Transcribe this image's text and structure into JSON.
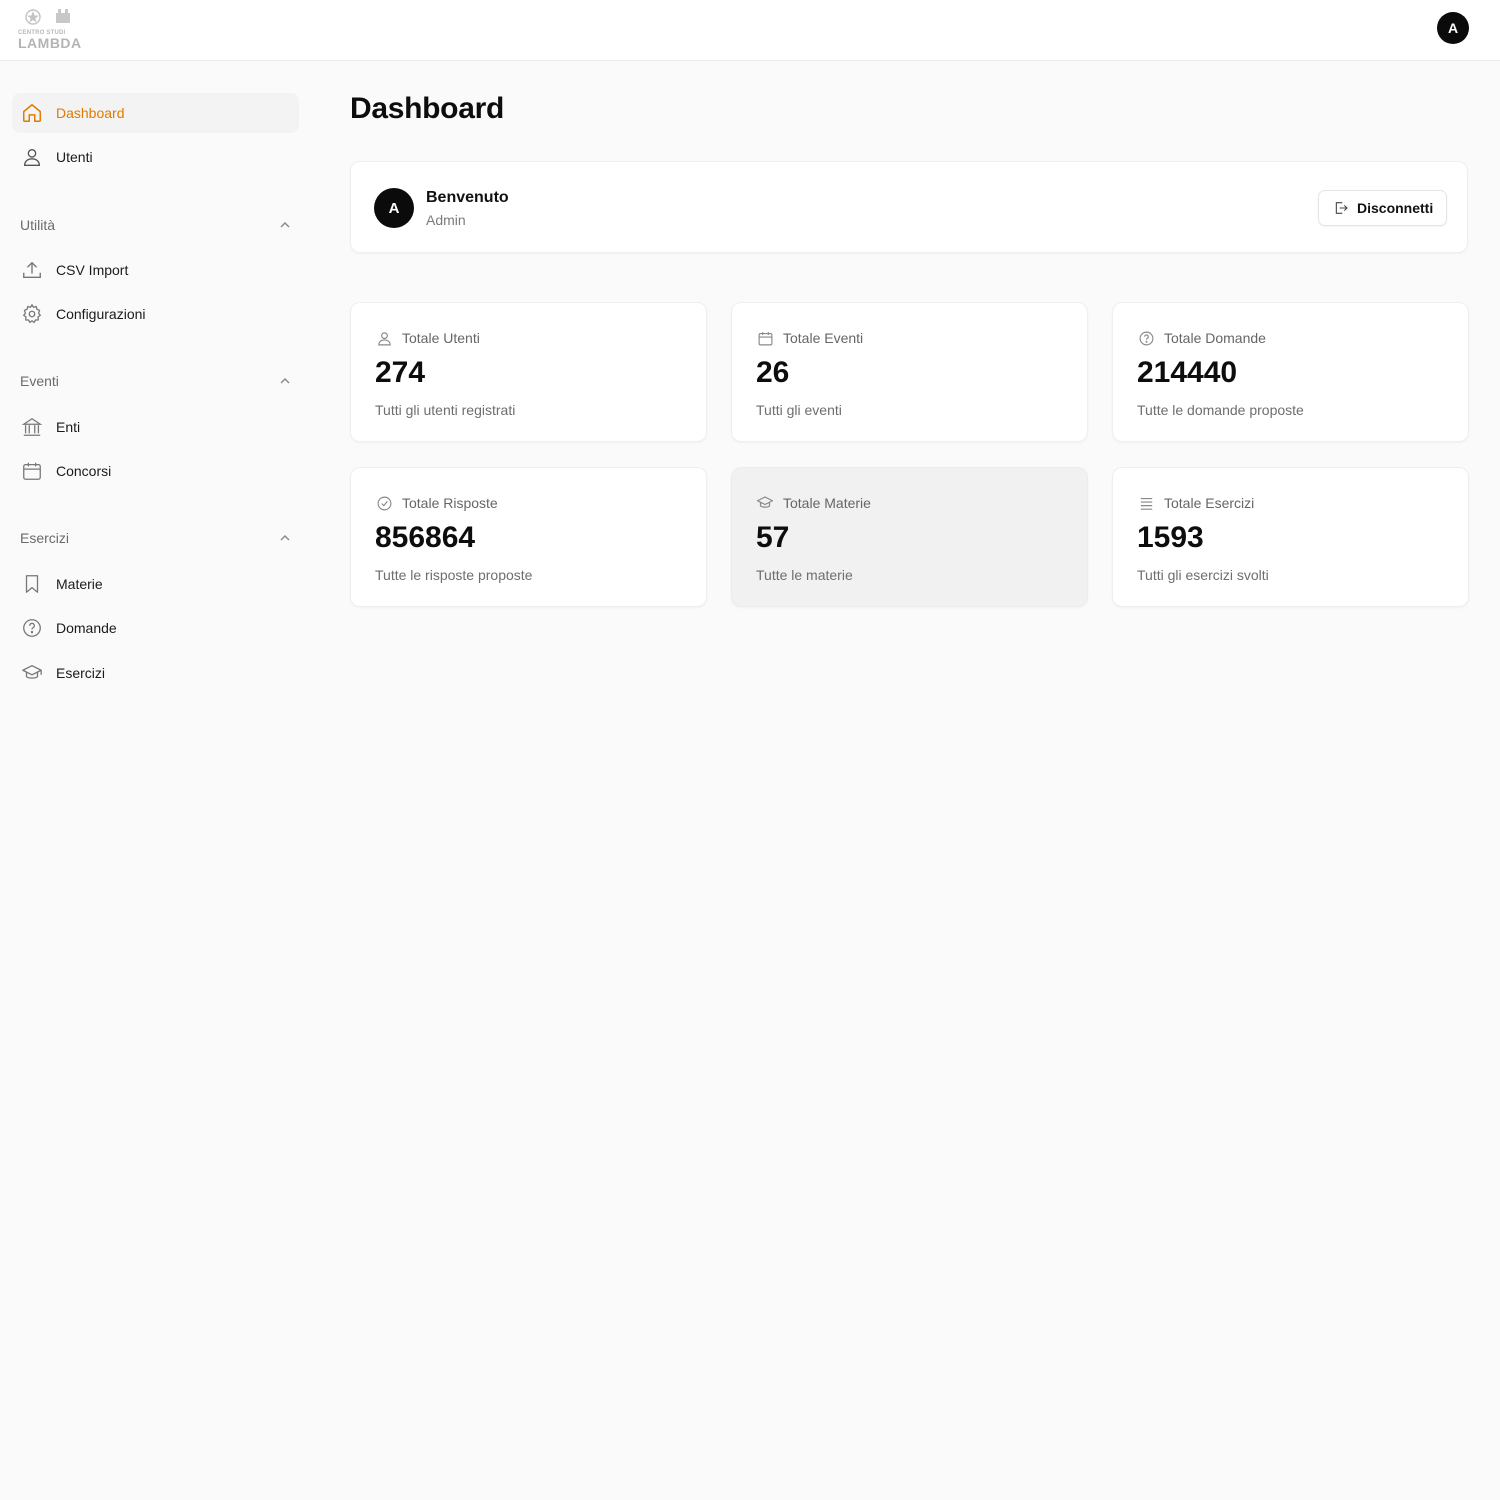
{
  "header": {
    "logo_small": "CENTRO STUDI",
    "logo_text": "LAMBDA",
    "avatar_initial": "A"
  },
  "sidebar": {
    "items": [
      {
        "label": "Dashboard",
        "icon": "home-icon",
        "active": true
      },
      {
        "label": "Utenti",
        "icon": "user-icon"
      }
    ],
    "sections": [
      {
        "title": "Utilità",
        "items": [
          {
            "label": "CSV Import",
            "icon": "upload-icon"
          },
          {
            "label": "Configurazioni",
            "icon": "gear-icon"
          }
        ]
      },
      {
        "title": "Eventi",
        "items": [
          {
            "label": "Enti",
            "icon": "building-icon"
          },
          {
            "label": "Concorsi",
            "icon": "calendar-icon"
          }
        ]
      },
      {
        "title": "Esercizi",
        "items": [
          {
            "label": "Materie",
            "icon": "bookmark-icon"
          },
          {
            "label": "Domande",
            "icon": "question-circle-icon"
          },
          {
            "label": "Esercizi",
            "icon": "graduation-cap-icon"
          }
        ]
      }
    ]
  },
  "main": {
    "title": "Dashboard",
    "welcome": {
      "avatar_initial": "A",
      "title": "Benvenuto",
      "subtitle": "Admin",
      "logout_label": "Disconnetti"
    },
    "stats": [
      {
        "label": "Totale Utenti",
        "value": "274",
        "desc": "Tutti gli utenti registrati",
        "icon": "user-icon"
      },
      {
        "label": "Totale Eventi",
        "value": "26",
        "desc": "Tutti gli eventi",
        "icon": "calendar-icon"
      },
      {
        "label": "Totale Domande",
        "value": "214440",
        "desc": "Tutte le domande proposte",
        "icon": "question-circle-icon"
      },
      {
        "label": "Totale Risposte",
        "value": "856864",
        "desc": "Tutte le risposte proposte",
        "icon": "check-circle-icon"
      },
      {
        "label": "Totale Materie",
        "value": "57",
        "desc": "Tutte le materie",
        "icon": "graduation-cap-icon"
      },
      {
        "label": "Totale Esercizi",
        "value": "1593",
        "desc": "Tutti gli esercizi svolti",
        "icon": "list-icon"
      }
    ]
  },
  "colors": {
    "accent": "#e07b00",
    "avatar_bg": "#0b0b0b",
    "page_bg": "#fafafa"
  }
}
